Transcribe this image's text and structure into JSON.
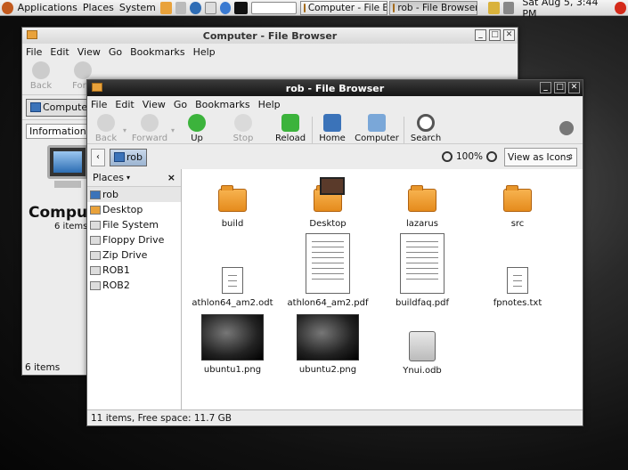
{
  "panel": {
    "applications": "Applications",
    "places": "Places",
    "system": "System",
    "tasks": [
      {
        "label": "Computer - File B"
      },
      {
        "label": "rob - File Browser"
      }
    ],
    "datetime": "Sat Aug  5,  3:44 PM"
  },
  "back_window": {
    "title": "Computer - File Browser",
    "menu": [
      "File",
      "Edit",
      "View",
      "Go",
      "Bookmarks",
      "Help"
    ],
    "toolbar": [
      "Back",
      "Forw"
    ],
    "location": "Compute",
    "info_select": "Information",
    "big_label": "Comput",
    "big_sub": "6 items",
    "status": "6 items"
  },
  "front_window": {
    "title": "rob - File Browser",
    "menu": [
      "File",
      "Edit",
      "View",
      "Go",
      "Bookmarks",
      "Help"
    ],
    "toolbar": {
      "back": "Back",
      "forward": "Forward",
      "up": "Up",
      "stop": "Stop",
      "reload": "Reload",
      "home": "Home",
      "computer": "Computer",
      "search": "Search"
    },
    "crumb": "rob",
    "zoom": "100%",
    "view_mode": "View as Icons",
    "places_header": "Places",
    "places": [
      "rob",
      "Desktop",
      "File System",
      "Floppy Drive",
      "Zip Drive",
      "ROB1",
      "ROB2"
    ],
    "files": [
      "build",
      "Desktop",
      "lazarus",
      "src",
      "athlon64_am2.odt",
      "athlon64_am2.pdf",
      "buildfaq.pdf",
      "fpnotes.txt",
      "ubuntu1.png",
      "ubuntu2.png",
      "Ynui.odb"
    ],
    "status": "11 items, Free space: 11.7 GB"
  }
}
